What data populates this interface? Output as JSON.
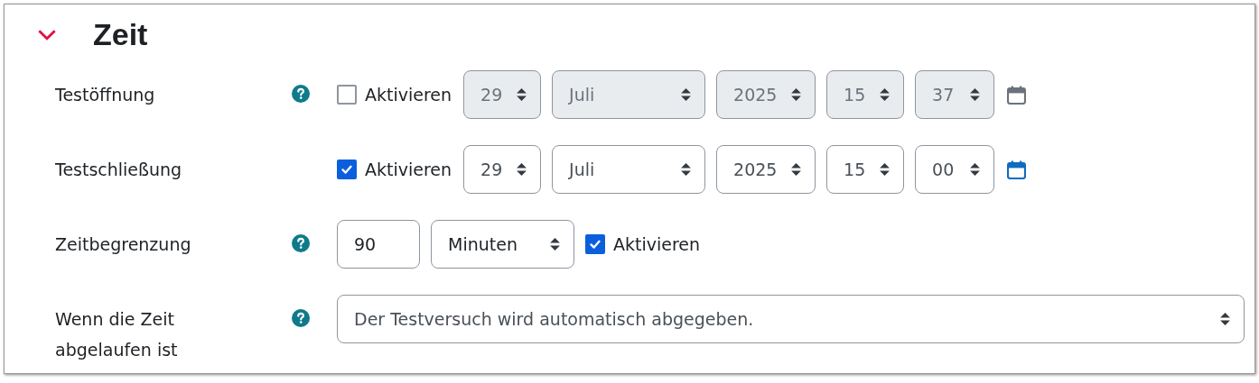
{
  "section": {
    "title": "Zeit",
    "expanded": true
  },
  "rows": [
    {
      "kind": "datetime",
      "label": "Testöffnung",
      "help": true,
      "enable_label": "Aktivieren",
      "enabled": false,
      "fields": [
        {
          "kind": "day",
          "value": "29"
        },
        {
          "kind": "month",
          "value": "Juli"
        },
        {
          "kind": "year",
          "value": "2025"
        },
        {
          "kind": "hour",
          "value": "15"
        },
        {
          "kind": "minute",
          "value": "37"
        }
      ]
    },
    {
      "kind": "datetime",
      "label": "Testschließung",
      "help": false,
      "enable_label": "Aktivieren",
      "enabled": true,
      "fields": [
        {
          "kind": "day",
          "value": "29"
        },
        {
          "kind": "month",
          "value": "Juli"
        },
        {
          "kind": "year",
          "value": "2025"
        },
        {
          "kind": "hour",
          "value": "15"
        },
        {
          "kind": "minute",
          "value": "00"
        }
      ]
    },
    {
      "kind": "duration",
      "label": "Zeitbegrenzung",
      "help": true,
      "value": "90",
      "unit": "Minuten",
      "enable_label": "Aktivieren",
      "enabled": true
    },
    {
      "kind": "select",
      "label": "Wenn die Zeit abgelaufen ist",
      "help": true,
      "value": "Der Testversuch wird automatisch abgegeben."
    }
  ]
}
